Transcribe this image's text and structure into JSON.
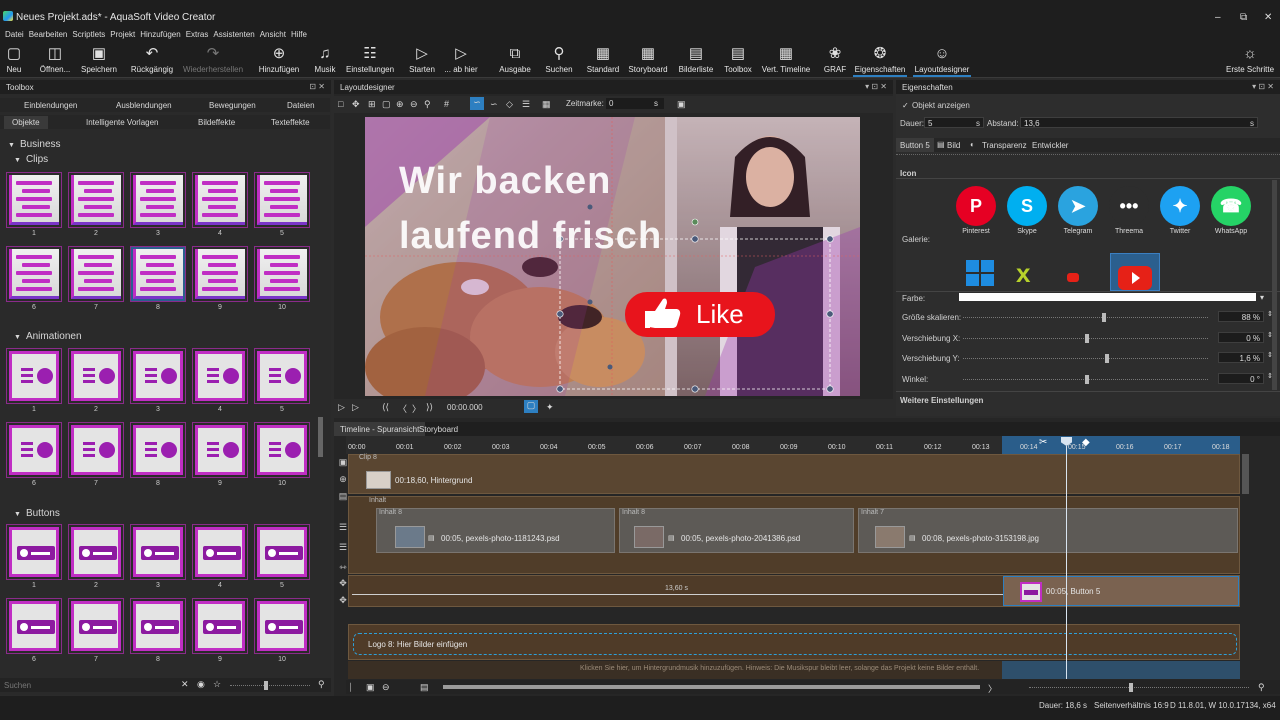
{
  "window": {
    "title": "Neues Projekt.ads* - AquaSoft Video Creator",
    "minimize": "–",
    "restore": "⧉",
    "close": "✕"
  },
  "menu": [
    "Datei",
    "Bearbeiten",
    "Scriptlets",
    "Projekt",
    "Hinzufügen",
    "Extras",
    "Assistenten",
    "Ansicht",
    "Hilfe"
  ],
  "toolbar": {
    "neu": "Neu",
    "oeffnen": "Öffnen...",
    "speichern": "Speichern",
    "rueckgaengig": "Rückgängig",
    "wiederherstellen": "Wiederherstellen",
    "hinzufuegen": "Hinzufügen",
    "musik": "Musik",
    "einstellungen": "Einstellungen",
    "starten": "Starten",
    "ab_hier": "... ab hier",
    "ausgabe": "Ausgabe",
    "suchen": "Suchen",
    "standard": "Standard",
    "storyboard": "Storyboard",
    "bilderliste": "Bilderliste",
    "toolbox": "Toolbox",
    "vert_timeline": "Vert. Timeline",
    "graf": "GRAF",
    "eigenschaften": "Eigenschaften",
    "layoutdesigner": "Layoutdesigner",
    "erste_schritte": "Erste Schritte"
  },
  "toolbox": {
    "title": "Toolbox",
    "tabs_row1": [
      "Einblendungen",
      "Ausblendungen",
      "Bewegungen",
      "Dateien"
    ],
    "tabs_row2": [
      "Objekte",
      "Intelligente Vorlagen",
      "Bildeffekte",
      "Texteffekte"
    ],
    "category": "Business",
    "sections": {
      "clips": "Clips",
      "animationen": "Animationen",
      "buttons": "Buttons"
    },
    "clip_labels": [
      "1",
      "2",
      "3",
      "4",
      "5",
      "6",
      "7",
      "8",
      "9",
      "10"
    ],
    "anim_labels": [
      "1",
      "2",
      "3",
      "4",
      "5",
      "6",
      "7",
      "8",
      "9",
      "10"
    ],
    "button_labels": [
      "1",
      "2",
      "3",
      "4",
      "5",
      "6",
      "7",
      "8",
      "9",
      "10"
    ],
    "search_placeholder": "Suchen"
  },
  "layout": {
    "title": "Layoutdesigner",
    "zeitmarke_label": "Zeitmarke:",
    "zeitmarke_value": "0",
    "zeitmarke_unit": "s",
    "canvas_text_line1": "Wir backen",
    "canvas_text_line2": "laufend frisch",
    "like_label": "Like",
    "time_display": "00:00.000"
  },
  "props": {
    "title": "Eigenschaften",
    "objekt_anzeigen": "Objekt anzeigen",
    "dauer_label": "Dauer:",
    "dauer_value": "5",
    "dauer_unit": "s",
    "abstand_label": "Abstand:",
    "abstand_value": "13,6",
    "abstand_unit": "s",
    "tabs": [
      "Button 5",
      "Bild",
      "Transparenz",
      "Entwickler"
    ],
    "icon_heading": "Icon",
    "galerie_label": "Galerie:",
    "gallery": [
      {
        "name": "Pinterest",
        "glyph": "P",
        "color": "#e60023"
      },
      {
        "name": "Skype",
        "glyph": "S",
        "color": "#00aff0"
      },
      {
        "name": "Telegram",
        "glyph": "➤",
        "color": "#2aa3df"
      },
      {
        "name": "Threema",
        "glyph": "•••",
        "color": "#2d2d2d"
      },
      {
        "name": "Twitter",
        "glyph": "✦",
        "color": "#1da1f2"
      },
      {
        "name": "WhatsApp",
        "glyph": "☎",
        "color": "#25d366"
      }
    ],
    "farbe_label": "Farbe:",
    "groesse_label": "Größe skalieren:",
    "groesse_value": "88 %",
    "versch_x_label": "Verschiebung X:",
    "versch_x_value": "0 %",
    "versch_y_label": "Verschiebung Y:",
    "versch_y_value": "1,6 %",
    "winkel_label": "Winkel:",
    "winkel_value": "0 °",
    "weitere": "Weitere Einstellungen"
  },
  "timeline": {
    "tabs": [
      "Timeline - Spuransicht",
      "Storyboard"
    ],
    "ticks": [
      "00:00",
      "00:01",
      "00:02",
      "00:03",
      "00:04",
      "00:05",
      "00:06",
      "00:07",
      "00:08",
      "00:09",
      "00:10",
      "00:11",
      "00:12",
      "00:13",
      "00:14",
      "00:15",
      "00:16",
      "00:17",
      "00:18"
    ],
    "clip8": "Clip 8",
    "hintergrund": "00:18,60, Hintergrund",
    "inhalt": "Inhalt",
    "inhalt8": "Inhalt 8",
    "inhalt8b": "Inhalt 8",
    "inhalt7": "Inhalt 7",
    "photo1": "00:05, pexels-photo-1181243.psd",
    "photo2": "00:05, pexels-photo-2041386.psd",
    "photo3": "00:08, pexels-photo-3153198.jpg",
    "gap": "13,60 s",
    "button5": "00:05, Button 5",
    "logo": "Logo 8: Hier Bilder einfügen",
    "music_hint": "Klicken Sie hier, um Hintergrundmusik hinzuzufügen. Hinweis: Die Musikspur bleibt leer, solange das Projekt keine Bilder enthält."
  },
  "status": {
    "dauer": "Dauer: 18,6 s",
    "seitenverhaeltnis": "Seitenverhältnis 16:9",
    "version": "D 11.8.01, W 10.0.17134, x64"
  }
}
